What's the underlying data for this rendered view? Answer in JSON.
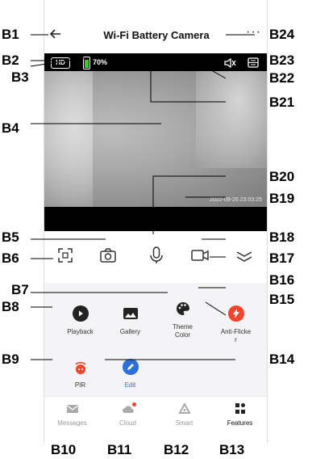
{
  "header": {
    "title": "Wi-Fi Battery Camera"
  },
  "video": {
    "quality_badge": "HD",
    "battery_level": "70%",
    "timestamp": "2022-09-26 23:03:25"
  },
  "features": [
    {
      "label": "Playback",
      "icon": "play-icon",
      "color": "#222222"
    },
    {
      "label": "Gallery",
      "icon": "image-icon",
      "color": "#222222"
    },
    {
      "label": "Theme\nColor",
      "icon": "palette-icon",
      "color": "#222222"
    },
    {
      "label": "Anti-Flicke\nr",
      "icon": "flash-icon",
      "color": "#f2452c"
    },
    {
      "label": "PIR",
      "icon": "pir-icon",
      "color": "#f2452c"
    },
    {
      "label": "Edit",
      "icon": "edit-icon",
      "color": "#2a6fdb"
    }
  ],
  "tabs": [
    {
      "label": "Messages",
      "icon": "mail-icon",
      "active": false
    },
    {
      "label": "Cloud",
      "icon": "cloud-icon",
      "active": false
    },
    {
      "label": "Smart",
      "icon": "smart-icon",
      "active": false
    },
    {
      "label": "Features",
      "icon": "grid-icon",
      "active": true
    }
  ],
  "callouts": {
    "b1": "B1",
    "b2": "B2",
    "b3": "B3",
    "b4": "B4",
    "b5": "B5",
    "b6": "B6",
    "b7": "B7",
    "b8": "B8",
    "b9": "B9",
    "b10": "B10",
    "b11": "B11",
    "b12": "B12",
    "b13": "B13",
    "b14": "B14",
    "b15": "B15",
    "b16": "B16",
    "b17": "B17",
    "b18": "B18",
    "b19": "B19",
    "b20": "B20",
    "b21": "B21",
    "b22": "B22",
    "b23": "B23",
    "b24": "B24"
  },
  "colors": {
    "accent": "#2a6fdb",
    "alert": "#f2452c",
    "battery": "#33cc33"
  }
}
